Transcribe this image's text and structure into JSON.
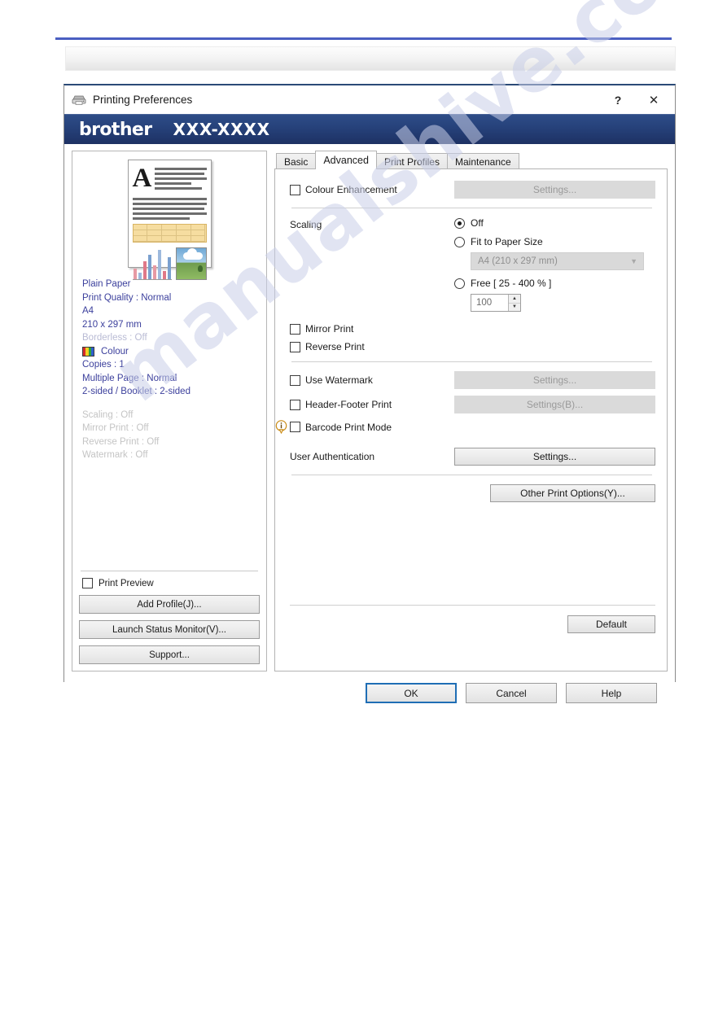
{
  "window": {
    "title": "Printing Preferences",
    "printer_icon": "printer-icon",
    "help_button": "?",
    "close_button": "✕"
  },
  "banner": {
    "brand": "brother",
    "model": "XXX-XXXX"
  },
  "preview": {
    "settings_lines": [
      {
        "text": "Plain Paper",
        "state": "normal"
      },
      {
        "text": "Print Quality : Normal",
        "state": "normal"
      },
      {
        "text": "A4",
        "state": "normal"
      },
      {
        "text": "210 x 297 mm",
        "state": "normal"
      },
      {
        "text": "Borderless : Off",
        "state": "dim"
      }
    ],
    "colour_label": "Colour",
    "settings_lines2": [
      {
        "text": "Copies : 1",
        "state": "normal"
      },
      {
        "text": "Multiple Page : Normal",
        "state": "normal"
      },
      {
        "text": "2-sided / Booklet : 2-sided",
        "state": "normal"
      }
    ],
    "settings_lines3": [
      {
        "text": "Scaling : Off",
        "state": "gray"
      },
      {
        "text": "Mirror Print : Off",
        "state": "gray"
      },
      {
        "text": "Reverse Print : Off",
        "state": "gray"
      },
      {
        "text": "Watermark : Off",
        "state": "gray"
      }
    ],
    "print_preview_label": "Print Preview",
    "print_preview_checked": false,
    "buttons": {
      "add_profile": "Add Profile(J)...",
      "launch_status_monitor": "Launch Status Monitor(V)...",
      "support": "Support..."
    }
  },
  "tabs": [
    {
      "label": "Basic",
      "active": false
    },
    {
      "label": "Advanced",
      "active": true
    },
    {
      "label": "Print Profiles",
      "active": false
    },
    {
      "label": "Maintenance",
      "active": false
    }
  ],
  "advanced": {
    "colour_enhancement": {
      "label": "Colour Enhancement",
      "checked": false,
      "settings_button": "Settings...",
      "settings_disabled": true
    },
    "scaling": {
      "label": "Scaling",
      "options": [
        {
          "label": "Off",
          "selected": true
        },
        {
          "label": "Fit to Paper Size",
          "selected": false
        },
        {
          "label": "Free [ 25 - 400 % ]",
          "selected": false
        }
      ],
      "paper_size_value": "A4 (210 x 297 mm)",
      "paper_size_disabled": true,
      "free_value": "100",
      "free_disabled": true
    },
    "mirror_print": {
      "label": "Mirror Print",
      "checked": false
    },
    "reverse_print": {
      "label": "Reverse Print",
      "checked": false
    },
    "use_watermark": {
      "label": "Use Watermark",
      "checked": false,
      "settings_button": "Settings...",
      "settings_disabled": true
    },
    "header_footer_print": {
      "label": "Header-Footer Print",
      "checked": false,
      "settings_button": "Settings(B)...",
      "settings_disabled": true
    },
    "barcode_print_mode": {
      "label": "Barcode Print Mode",
      "checked": false,
      "info_icon": "info-icon"
    },
    "user_authentication": {
      "label": "User Authentication",
      "settings_button": "Settings..."
    },
    "other_print_options": "Other Print Options(Y)...",
    "default_button": "Default"
  },
  "actions": {
    "ok": "OK",
    "cancel": "Cancel",
    "help": "Help"
  },
  "watermark_text": "manualshive.com",
  "colors": {
    "banner_blue": "#26417a",
    "accent_blue": "#3b3f9c",
    "focus_blue": "#1f6eb5",
    "page_rule": "#4a5fc1"
  }
}
